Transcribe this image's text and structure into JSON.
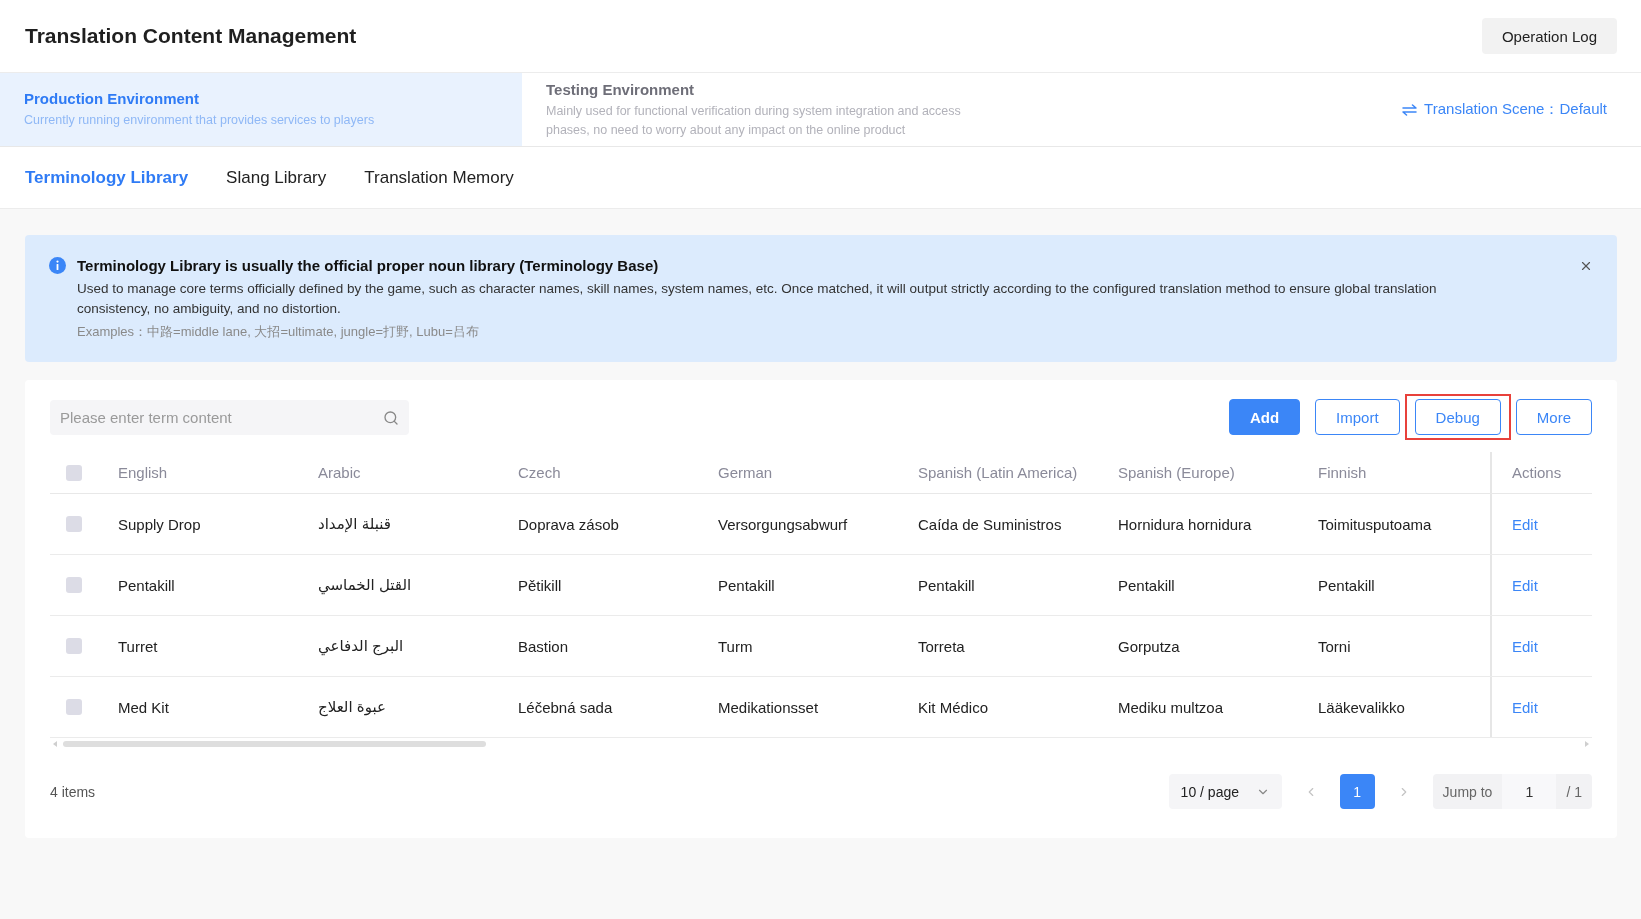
{
  "header": {
    "title": "Translation Content Management",
    "operation_log_button": "Operation Log"
  },
  "environments": [
    {
      "title": "Production Environment",
      "description": "Currently running environment that provides services to players",
      "selected": true
    },
    {
      "title": "Testing Environment",
      "description": "Mainly used for functional verification during system integration and access phases, no need to worry about any impact on the online product",
      "selected": false
    }
  ],
  "translation_scene": {
    "label": "Translation Scene：",
    "value": "Default"
  },
  "library_tabs": [
    {
      "label": "Terminology Library",
      "selected": true
    },
    {
      "label": "Slang Library",
      "selected": false
    },
    {
      "label": "Translation Memory",
      "selected": false
    }
  ],
  "notice": {
    "title": "Terminology Library is usually the official proper noun library (Terminology Base)",
    "body": "Used to manage core terms officially defined by the game, such as character names, skill names, system names, etc. Once matched, it will output strictly according to the configured translation method to ensure global translation consistency, no ambiguity, and no distortion.",
    "examples": "Examples：中路=middle lane, 大招=ultimate, jungle=打野, Lubu=吕布"
  },
  "toolbar": {
    "search": {
      "placeholder": "Please enter term content"
    },
    "buttons": [
      {
        "label": "Add",
        "kind": "primary",
        "highlighted": false
      },
      {
        "label": "Import",
        "kind": "outline",
        "highlighted": false
      },
      {
        "label": "Debug",
        "kind": "outline",
        "highlighted": true
      },
      {
        "label": "More",
        "kind": "outline",
        "highlighted": false
      }
    ]
  },
  "table": {
    "all_checked": false,
    "columns": [
      "English",
      "Arabic",
      "Czech",
      "German",
      "Spanish (Latin America)",
      "Spanish (Europe)",
      "Finnish"
    ],
    "actions_column": "Actions",
    "rows": [
      {
        "checked": false,
        "cells": [
          "Supply Drop",
          "قنبلة الإمداد",
          "Doprava zásob",
          "Versorgungsabwurf",
          "Caída de Suministros",
          "Hornidura hornidura",
          "Toimitusputoama"
        ],
        "action": "Edit"
      },
      {
        "checked": false,
        "cells": [
          "Pentakill",
          "القتل الخماسي",
          "Pětikill",
          "Pentakill",
          "Pentakill",
          "Pentakill",
          "Pentakill"
        ],
        "action": "Edit"
      },
      {
        "checked": false,
        "cells": [
          "Turret",
          "البرج الدفاعي",
          "Bastion",
          "Turm",
          "Torreta",
          "Gorputza",
          "Torni"
        ],
        "action": "Edit"
      },
      {
        "checked": false,
        "cells": [
          "Med Kit",
          "عبوة العلاج",
          "Léčebná sada",
          "Medikationsset",
          "Kit Médico",
          "Mediku multzoa",
          "Lääkevalikko"
        ],
        "action": "Edit"
      }
    ]
  },
  "footer": {
    "total": "4 items",
    "page_size": "10 / page",
    "prev_disabled": true,
    "pages": [
      {
        "label": "1",
        "selected": true
      }
    ],
    "next_disabled": true,
    "jump_label": "Jump to",
    "jump_value": "1",
    "page_count": "/ 1"
  }
}
